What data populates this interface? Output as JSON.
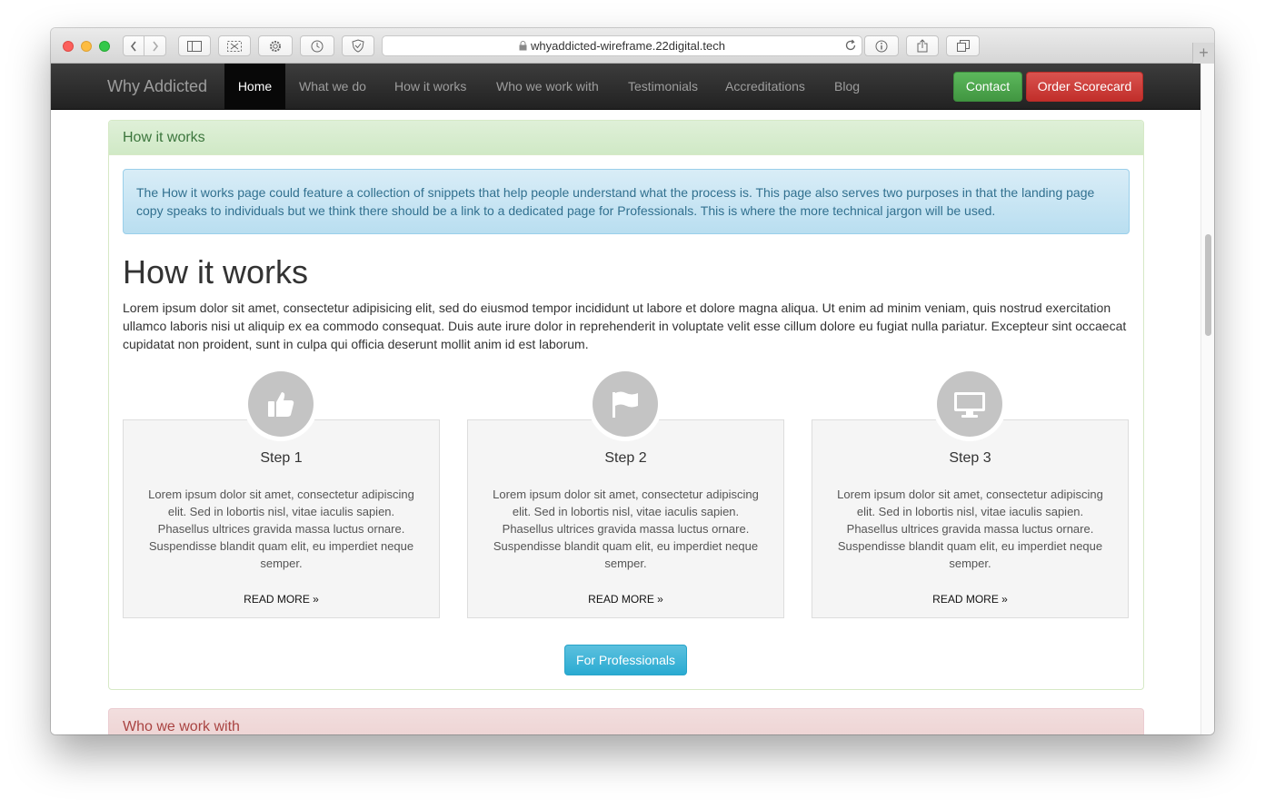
{
  "browser": {
    "url": "whyaddicted-wireframe.22digital.tech",
    "new_tab_symbol": "+"
  },
  "navbar": {
    "brand": "Why Addicted",
    "items": [
      {
        "label": "Home",
        "active": true
      },
      {
        "label": "What we do"
      },
      {
        "label": "How it works"
      },
      {
        "label": "Who we work with"
      },
      {
        "label": "Testimonials"
      },
      {
        "label": "Accreditations"
      },
      {
        "label": "Blog"
      }
    ],
    "contact_label": "Contact",
    "order_label": "Order Scorecard"
  },
  "section": {
    "heading": "How it works",
    "alert": "The How it works page could feature a collection of snippets that help people understand what the process is. This page also serves two purposes in that the landing page copy speaks to individuals but we think there should be a link to a dedicated page for Professionals. This is where the more technical jargon will be used.",
    "title": "How it works",
    "intro": "Lorem ipsum dolor sit amet, consectetur adipisicing elit, sed do eiusmod tempor incididunt ut labore et dolore magna aliqua. Ut enim ad minim veniam, quis nostrud exercitation ullamco laboris nisi ut aliquip ex ea commodo consequat. Duis aute irure dolor in reprehenderit in voluptate velit esse cillum dolore eu fugiat nulla pariatur. Excepteur sint occaecat cupidatat non proident, sunt in culpa qui officia deserunt mollit anim id est laborum.",
    "steps": [
      {
        "icon": "thumbs-up-icon",
        "title": "Step 1",
        "text": "Lorem ipsum dolor sit amet, consectetur adipiscing elit. Sed in lobortis nisl, vitae iaculis sapien. Phasellus ultrices gravida massa luctus ornare. Suspendisse blandit quam elit, eu imperdiet neque semper.",
        "more": "READ MORE »"
      },
      {
        "icon": "flag-icon",
        "title": "Step 2",
        "text": "Lorem ipsum dolor sit amet, consectetur adipiscing elit. Sed in lobortis nisl, vitae iaculis sapien. Phasellus ultrices gravida massa luctus ornare. Suspendisse blandit quam elit, eu imperdiet neque semper.",
        "more": "READ MORE »"
      },
      {
        "icon": "monitor-icon",
        "title": "Step 3",
        "text": "Lorem ipsum dolor sit amet, consectetur adipiscing elit. Sed in lobortis nisl, vitae iaculis sapien. Phasellus ultrices gravida massa luctus ornare. Suspendisse blandit quam elit, eu imperdiet neque semper.",
        "more": "READ MORE »"
      }
    ],
    "professionals_label": "For Professionals"
  },
  "next_section": {
    "heading": "Who we work with"
  },
  "colors": {
    "navbar": "#222222",
    "contact": "#5cb85c",
    "order": "#d9534f",
    "panel_success": "#dff0d8",
    "panel_danger": "#f2dede",
    "info_button": "#5bc0de"
  }
}
